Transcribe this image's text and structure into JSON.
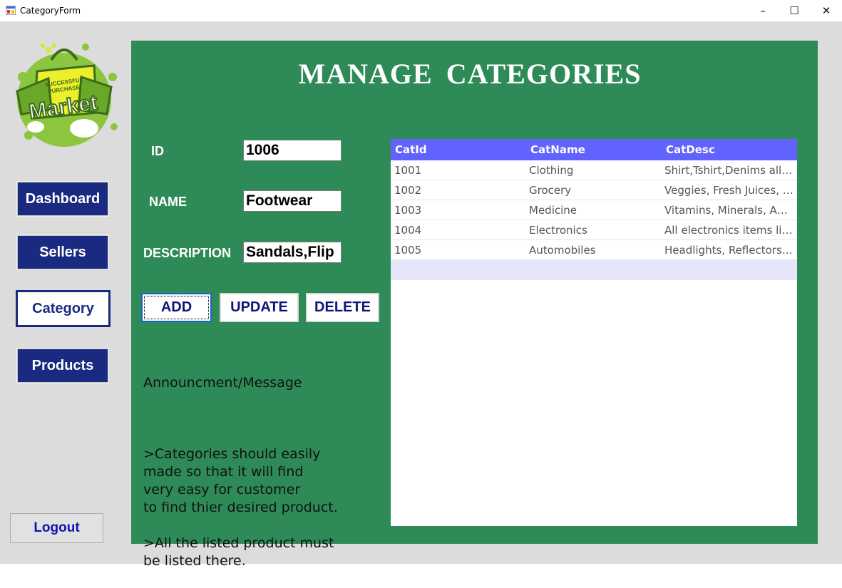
{
  "window": {
    "title": "CategoryForm",
    "minimize": "–",
    "maximize": "☐",
    "close": "✕"
  },
  "logo": {
    "line1": "SUCCESSFUL",
    "line2": "PURCHASE",
    "word": "Market"
  },
  "nav": {
    "dashboard": "Dashboard",
    "sellers": "Sellers",
    "category": "Category",
    "products": "Products",
    "logout": "Logout"
  },
  "page": {
    "title": "MANAGE  CATEGORIES"
  },
  "form": {
    "id_label": "ID",
    "id_value": "1006",
    "name_label": "NAME",
    "name_value": "Footwear",
    "desc_label": "DESCRIPTION",
    "desc_value": "Sandals,Flip"
  },
  "actions": {
    "add": "ADD",
    "update": "UPDATE",
    "delete": "DELETE"
  },
  "message": {
    "heading": "Announcment/Message",
    "body": ">Categories should easily\nmade so that it will find\nvery easy for customer\nto find thier desired product.\n\n>All the listed product must\nbe listed there."
  },
  "grid": {
    "columns": [
      "CatId",
      "CatName",
      "CatDesc"
    ],
    "rows": [
      {
        "id": "1001",
        "name": "Clothing",
        "desc": "Shirt,Tshirt,Denims all w..."
      },
      {
        "id": "1002",
        "name": "Grocery",
        "desc": "Veggies, Fresh Juices, Li..."
      },
      {
        "id": "1003",
        "name": "Medicine",
        "desc": "Vitamins, Minerals, Antia..."
      },
      {
        "id": "1004",
        "name": "Electronics",
        "desc": "All electronics items like ..."
      },
      {
        "id": "1005",
        "name": "Automobiles",
        "desc": "Headlights, Reflectors, St..."
      }
    ]
  },
  "colors": {
    "panel": "#2e8b57",
    "nav_button": "#1a2a80",
    "grid_header": "#6262ff",
    "new_row": "#e6e6fa",
    "client_bg": "#dcdcdc"
  }
}
